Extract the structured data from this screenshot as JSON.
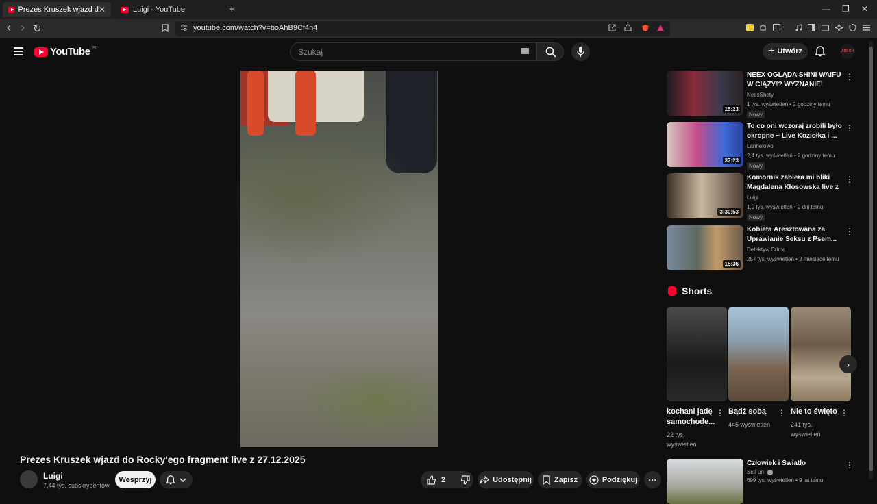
{
  "browser": {
    "tabs": [
      {
        "label": "Prezes Kruszek wjazd do Rocky'e",
        "active": true,
        "close": "✕"
      },
      {
        "label": "Luigi - YouTube",
        "active": false
      }
    ],
    "new_tab": "+",
    "window_controls": {
      "minimize": "—",
      "restore": "❐",
      "close": "✕"
    },
    "url": "youtube.com/watch?v=boAhB9Cf4n4",
    "nav": {
      "back": "‹",
      "forward": "›",
      "reload": "↻"
    }
  },
  "youtube": {
    "logo_text": "YouTube",
    "country_code": "PL",
    "search_placeholder": "Szukaj",
    "create_label": "Utwórz",
    "avatar_text": "ADRON"
  },
  "video": {
    "title": "Prezes Kruszek wjazd do Rocky'ego fragment live z 27.12.2025",
    "channel": "Luigi",
    "subscribers": "7,44 tys. subskrybentów",
    "support_label": "Wesprzyj",
    "like_count": "2",
    "share_label": "Udostępnij",
    "save_label": "Zapisz",
    "thanks_label": "Podziękuj",
    "more": "···"
  },
  "recommended": [
    {
      "title": "NEEX OGLĄDA SHINI WAIFU W CIĄŻY!? WYZNANIE! MAMMO...",
      "channel": "NeexShoty",
      "meta": "1 tys. wyświetleń • 2 godziny temu",
      "duration": "15:23",
      "badge": "Nowy",
      "thumb_colors": [
        "#6a2330",
        "#2a2a3a"
      ]
    },
    {
      "title": "To co oni wczoraj zrobili było okropne ~ Live Koziołka i ...",
      "channel": "Lannelowo",
      "meta": "2,4 tys. wyświetleń • 2 godziny temu",
      "duration": "37:23",
      "badge": "Nowy",
      "thumb_colors": [
        "#c44d8a",
        "#3e6ad6"
      ]
    },
    {
      "title": "Komornik zabiera mi bliki Magdalena Kłosowska live z ...",
      "channel": "Luigi",
      "meta": "1,9 tys. wyświetleń • 2 dni temu",
      "duration": "3:30:53",
      "badge": "Nowy",
      "thumb_colors": [
        "#6b5a4a",
        "#c8b7a0"
      ]
    },
    {
      "title": "Kobieta Aresztowana za Uprawianie Seksu z Psem...",
      "channel": "Detektyw Crime",
      "meta": "257 tys. wyświetleń • 2 miesiące temu",
      "duration": "15:36",
      "badge": "",
      "thumb_colors": [
        "#7a8aa0",
        "#c29a6a"
      ]
    }
  ],
  "shorts": {
    "heading": "Shorts",
    "items": [
      {
        "title": "kochani jadę samochode...",
        "views": "22 tys. wyświetleń",
        "colors": [
          "#3a3a3a",
          "#1a1a1a"
        ]
      },
      {
        "title": "Bądź sobą",
        "views": "445 wyświetleń",
        "colors": [
          "#a8c4d8",
          "#7a6450"
        ]
      },
      {
        "title": "Nie to święto",
        "views": "241 tys. wyświetleń",
        "colors": [
          "#6b5a48",
          "#b8a890"
        ]
      }
    ],
    "next": "›"
  },
  "recommended_bottom": {
    "title": "Człowiek i Światło",
    "channel": "SciFun",
    "meta": "699 tys. wyświetleń • 9 lat temu"
  }
}
